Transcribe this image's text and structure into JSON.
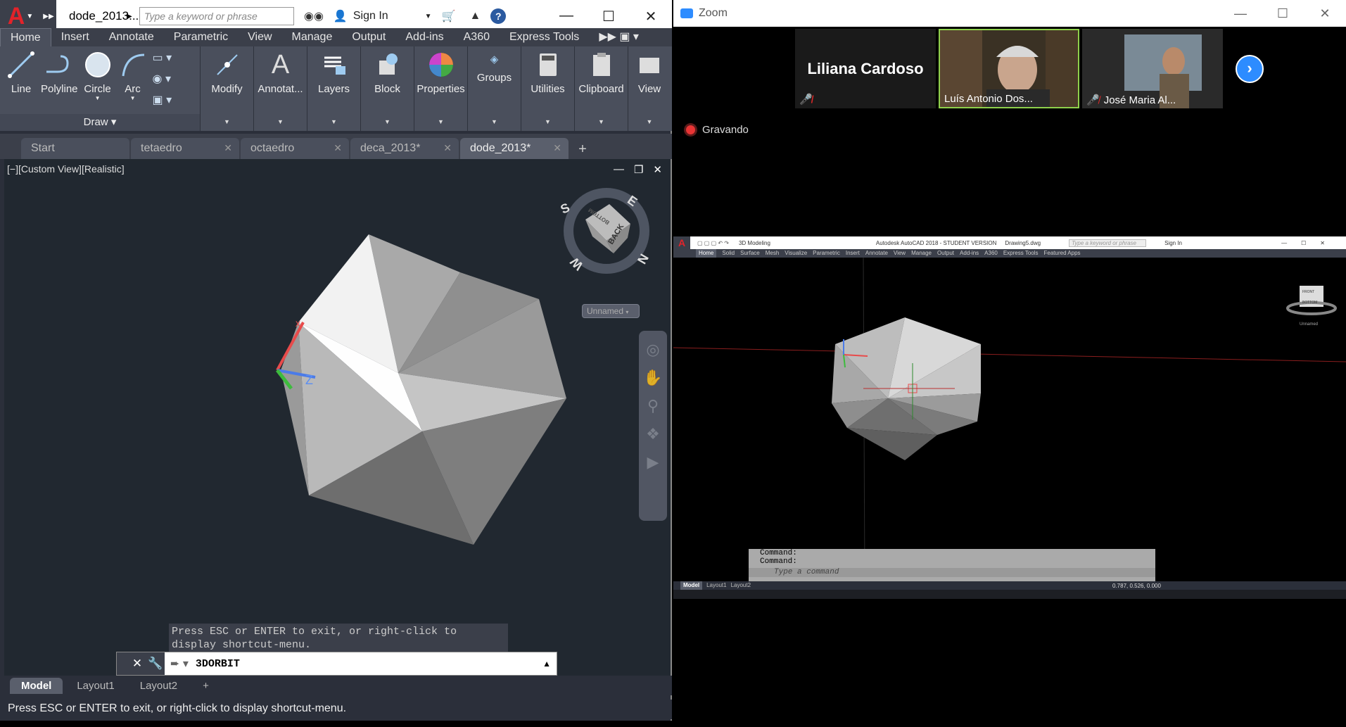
{
  "acad": {
    "doc_title": "dode_2013....",
    "search_placeholder": "Type a keyword or phrase",
    "sign_in": "Sign In",
    "tabs": [
      "Home",
      "Insert",
      "Annotate",
      "Parametric",
      "View",
      "Manage",
      "Output",
      "Add-ins",
      "A360",
      "Express Tools"
    ],
    "tools": {
      "line": "Line",
      "polyline": "Polyline",
      "circle": "Circle",
      "arc": "Arc",
      "modify": "Modify",
      "annotate": "Annotat...",
      "layers": "Layers",
      "block": "Block",
      "properties": "Properties",
      "groups": "Groups",
      "utilities": "Utilities",
      "clipboard": "Clipboard",
      "view": "View"
    },
    "draw_panel": "Draw",
    "file_tabs": [
      "Start",
      "tetaedro",
      "octaedro",
      "deca_2013*",
      "dode_2013*"
    ],
    "viewport_label": "[−][Custom View][Realistic]",
    "viewcube": {
      "compass": {
        "s": "S",
        "e": "E",
        "w": "W",
        "n": "N"
      },
      "face_top": "BOTTOM",
      "face_side": "BACK",
      "ucs_dropdown": "Unnamed"
    },
    "ucs_z_label": "Z",
    "prompt_tip": "Press ESC or ENTER to exit, or right-click to display shortcut-menu.",
    "command_value": "3DORBIT",
    "layout_tabs": [
      "Model",
      "Layout1",
      "Layout2"
    ],
    "status_text": "Press ESC or ENTER to exit, or right-click to display shortcut-menu.",
    "accent": "#e2232a",
    "viewport_bg": "#212830"
  },
  "zoom": {
    "title": "Zoom",
    "participants": [
      {
        "name": "Liliana Cardoso",
        "muted": true,
        "video": false
      },
      {
        "name": "Luís Antonio Dos...",
        "muted": false,
        "video": true
      },
      {
        "name": "José Maria Al...",
        "muted": true,
        "video": true
      }
    ],
    "recording_label": "Gravando",
    "accent": "#2d8cff"
  },
  "shared_screen": {
    "workspace": "3D Modeling",
    "app_title": "Autodesk AutoCAD 2018 - STUDENT VERSION",
    "drawing": "Drawing5.dwg",
    "search_placeholder": "Type a keyword or phrase",
    "sign_in": "Sign In",
    "tabs": [
      "Home",
      "Solid",
      "Surface",
      "Mesh",
      "Visualize",
      "Parametric",
      "Insert",
      "Annotate",
      "View",
      "Manage",
      "Output",
      "Add-ins",
      "A360",
      "Express Tools",
      "Featured Apps"
    ],
    "viewcube_top": "FRONT",
    "viewcube_side": "BOTTOM",
    "ucs_dropdown": "Unnamed",
    "command_lines": [
      "Command:",
      "Command:"
    ],
    "command_placeholder": "Type a command",
    "layout_tabs": [
      "Model",
      "Layout1",
      "Layout2"
    ],
    "coords": "0.787, 0.526, 0.000"
  }
}
